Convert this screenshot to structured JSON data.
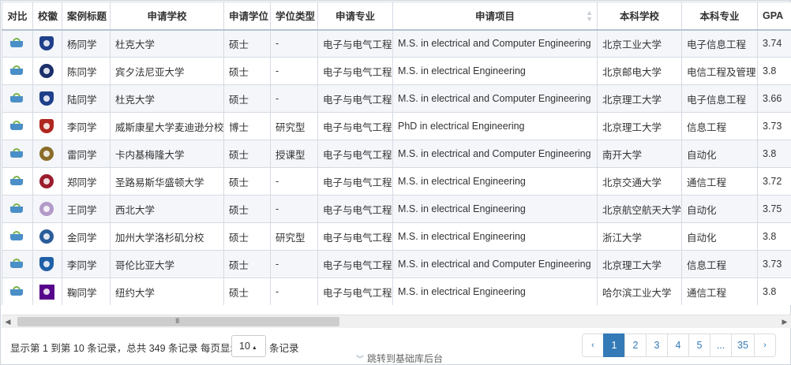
{
  "columns": [
    "对比",
    "校徽",
    "案例标题",
    "申请学校",
    "申请学位",
    "学位类型",
    "申请专业",
    "申请项目",
    "本科学校",
    "本科专业",
    "GPA"
  ],
  "rows": [
    {
      "title": "杨同学",
      "school": "杜克大学",
      "degree": "硕士",
      "degree_type": "-",
      "major": "电子与电气工程",
      "program": "M.S. in electrical and Computer Engineering",
      "undergrad_school": "北京工业大学",
      "undergrad_major": "电子信息工程",
      "gpa": "3.74",
      "badge_icon": "duke-logo-icon",
      "badge_color": "#1f3f8a",
      "badge_shape": "shield"
    },
    {
      "title": "陈同学",
      "school": "宾夕法尼亚大学",
      "degree": "硕士",
      "degree_type": "-",
      "major": "电子与电气工程",
      "program": "M.S. in electrical Engineering",
      "undergrad_school": "北京邮电大学",
      "undergrad_major": "电信工程及管理",
      "gpa": "3.8",
      "badge_icon": "upenn-seal-icon",
      "badge_color": "#1b2f6b",
      "badge_shape": "circle"
    },
    {
      "title": "陆同学",
      "school": "杜克大学",
      "degree": "硕士",
      "degree_type": "-",
      "major": "电子与电气工程",
      "program": "M.S. in electrical and Computer Engineering",
      "undergrad_school": "北京理工大学",
      "undergrad_major": "电子信息工程",
      "gpa": "3.66",
      "badge_icon": "duke-logo-icon",
      "badge_color": "#1f3f8a",
      "badge_shape": "shield"
    },
    {
      "title": "李同学",
      "school": "威斯康星大学麦迪逊分校",
      "degree": "博士",
      "degree_type": "研究型",
      "major": "电子与电气工程",
      "program": "PhD in electrical Engineering",
      "undergrad_school": "北京理工大学",
      "undergrad_major": "信息工程",
      "gpa": "3.73",
      "badge_icon": "wisconsin-crest-icon",
      "badge_color": "#b0261f",
      "badge_shape": "shield"
    },
    {
      "title": "雷同学",
      "school": "卡内基梅隆大学",
      "degree": "硕士",
      "degree_type": "授课型",
      "major": "电子与电气工程",
      "program": "M.S. in electrical and Computer Engineering",
      "undergrad_school": "南开大学",
      "undergrad_major": "自动化",
      "gpa": "3.8",
      "badge_icon": "cmu-seal-icon",
      "badge_color": "#8a6d2a",
      "badge_shape": "circle"
    },
    {
      "title": "郑同学",
      "school": "圣路易斯华盛顿大学",
      "degree": "硕士",
      "degree_type": "-",
      "major": "电子与电气工程",
      "program": "M.S. in electrical Engineering",
      "undergrad_school": "北京交通大学",
      "undergrad_major": "通信工程",
      "gpa": "3.72",
      "badge_icon": "washu-seal-icon",
      "badge_color": "#9b1c2c",
      "badge_shape": "circle"
    },
    {
      "title": "王同学",
      "school": "西北大学",
      "degree": "硕士",
      "degree_type": "-",
      "major": "电子与电气工程",
      "program": "M.S. in electrical Engineering",
      "undergrad_school": "北京航空航天大学",
      "undergrad_major": "自动化",
      "gpa": "3.75",
      "badge_icon": "northwestern-seal-icon",
      "badge_color": "#b39ac8",
      "badge_shape": "circle"
    },
    {
      "title": "金同学",
      "school": "加州大学洛杉矶分校",
      "degree": "硕士",
      "degree_type": "研究型",
      "major": "电子与电气工程",
      "program": "M.S. in electrical Engineering",
      "undergrad_school": "浙江大学",
      "undergrad_major": "自动化",
      "gpa": "3.8",
      "badge_icon": "ucla-seal-icon",
      "badge_color": "#2a5d9a",
      "badge_shape": "circle"
    },
    {
      "title": "李同学",
      "school": "哥伦比亚大学",
      "degree": "硕士",
      "degree_type": "-",
      "major": "电子与电气工程",
      "program": "M.S. in electrical and Computer Engineering",
      "undergrad_school": "北京理工大学",
      "undergrad_major": "信息工程",
      "gpa": "3.73",
      "badge_icon": "columbia-crown-icon",
      "badge_color": "#1f5fa8",
      "badge_shape": "shield"
    },
    {
      "title": "鞠同学",
      "school": "纽约大学",
      "degree": "硕士",
      "degree_type": "-",
      "major": "电子与电气工程",
      "program": "M.S. in electrical Engineering",
      "undergrad_school": "哈尔滨工业大学",
      "undergrad_major": "通信工程",
      "gpa": "3.8",
      "badge_icon": "nyu-torch-icon",
      "badge_color": "#57068c",
      "badge_shape": "square"
    }
  ],
  "footer": {
    "info": "显示第 1 到第 10 条记录，总共 349 条记录 每页显示",
    "page_size": "10",
    "page_size_suffix": "条记录",
    "pages": [
      "‹",
      "1",
      "2",
      "3",
      "4",
      "5",
      "...",
      "35",
      "›"
    ],
    "active_page": "1",
    "backlink": "跳转到基础库后台"
  },
  "scrollbar": {
    "grip": "III"
  },
  "colors": {
    "accent": "#337ab7",
    "row_stripe": "#f4f6fa",
    "border": "#d5dbe3"
  }
}
